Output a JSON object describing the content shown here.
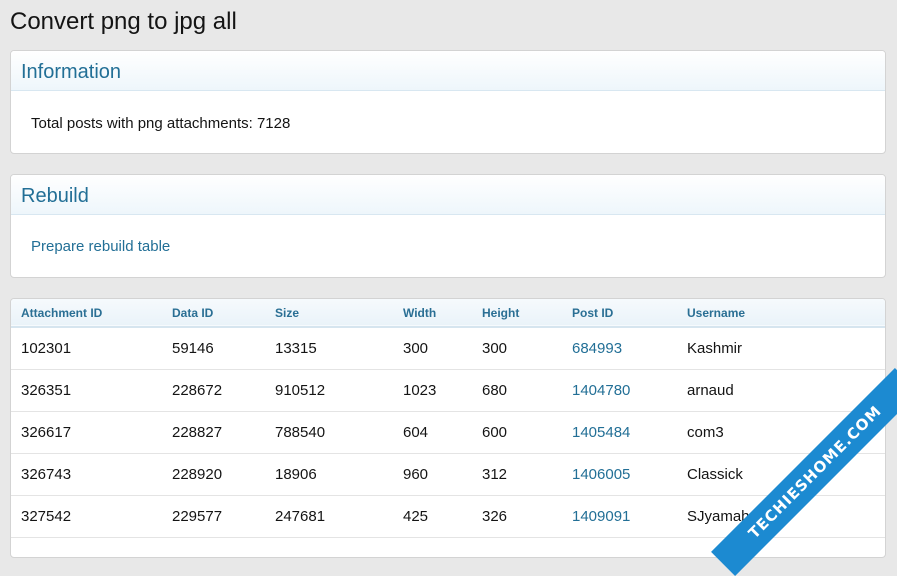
{
  "page": {
    "title": "Convert png to jpg all"
  },
  "information": {
    "heading": "Information",
    "text": "Total posts with png attachments: 7128"
  },
  "rebuild": {
    "heading": "Rebuild",
    "link": "Prepare rebuild table"
  },
  "table": {
    "columns": [
      "Attachment ID",
      "Data ID",
      "Size",
      "Width",
      "Height",
      "Post ID",
      "Username"
    ],
    "rows": [
      [
        "102301",
        "59146",
        "13315",
        "300",
        "300",
        "684993",
        "Kashmir"
      ],
      [
        "326351",
        "228672",
        "910512",
        "1023",
        "680",
        "1404780",
        "arnaud"
      ],
      [
        "326617",
        "228827",
        "788540",
        "604",
        "600",
        "1405484",
        "com3"
      ],
      [
        "326743",
        "228920",
        "18906",
        "960",
        "312",
        "1406005",
        "Classick"
      ],
      [
        "327542",
        "229577",
        "247681",
        "425",
        "326",
        "1409091",
        "SJyamaha"
      ]
    ]
  },
  "watermark": {
    "text": "TECHIESHOME.COM"
  }
}
